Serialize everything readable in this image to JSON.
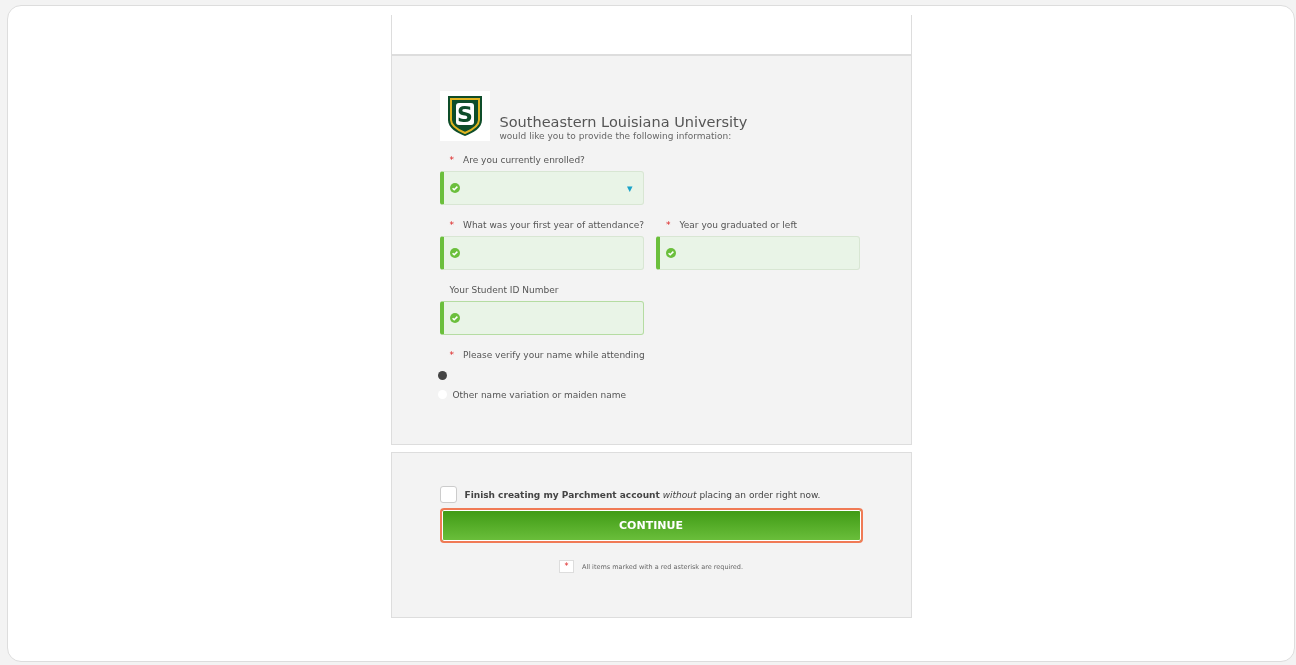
{
  "school": {
    "name": "Southeastern Louisiana University",
    "subtitle": "would like you to provide the following information:",
    "logo_letter": "S"
  },
  "fields": [
    {
      "label": "Are you currently enrolled?",
      "required_mark": "*",
      "kind": "select",
      "valid": true,
      "caret": "▾"
    },
    {
      "label": "What was your first year of attendance?",
      "required_mark": "*",
      "kind": "text",
      "valid": true
    },
    {
      "label": "Year you graduated or left",
      "required_mark": "*",
      "kind": "text",
      "valid": true
    },
    {
      "label": "Your Student ID Number",
      "kind": "text",
      "valid": true
    }
  ],
  "name_question": {
    "label": "Please verify your name while attending",
    "required_mark": "*",
    "options": [
      {
        "selected": true
      },
      {
        "label": "Other name variation or maiden name",
        "selected": false
      }
    ]
  },
  "account_option": {
    "label": "**Finish creating my Parchment account** *without* placing an order right now.",
    "checked": false
  },
  "continue_button": "CONTINUE",
  "legend": {
    "mark": "*",
    "text": "All items marked with a red asterisk are required."
  }
}
